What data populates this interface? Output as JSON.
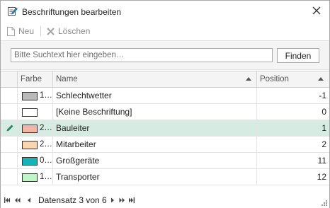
{
  "window": {
    "title": "Beschriftungen bearbeiten"
  },
  "toolbar": {
    "new_label": "Neu",
    "delete_label": "Löschen"
  },
  "search": {
    "placeholder": "Bitte Suchtext hier eingeben…",
    "find_label": "Finden"
  },
  "grid": {
    "columns": {
      "color": "Farbe",
      "name": "Name",
      "position": "Position"
    },
    "rows": [
      {
        "color_code": "1…",
        "color_hex": "#b9b9b9",
        "name": "Schlechtwetter",
        "position": "-1",
        "selected": false
      },
      {
        "color_code": "",
        "color_hex": "#ffffff",
        "name": "[Keine Beschriftung]",
        "position": "0",
        "selected": false
      },
      {
        "color_code": "2…",
        "color_hex": "#f2b5a8",
        "name": "Bauleiter",
        "position": "1",
        "selected": true
      },
      {
        "color_code": "2…",
        "color_hex": "#fcd5b0",
        "name": "Mitarbeiter",
        "position": "2",
        "selected": false
      },
      {
        "color_code": "0…",
        "color_hex": "#14b3b8",
        "name": "Großgeräte",
        "position": "11",
        "selected": false
      },
      {
        "color_code": "1…",
        "color_hex": "#bff5c7",
        "name": "Transporter",
        "position": "12",
        "selected": false
      }
    ]
  },
  "navigator": {
    "record_text": "Datensatz 3 von 6"
  },
  "colors": {
    "selected_row": "#d6ebe1",
    "accent": "#2e8b6f"
  }
}
